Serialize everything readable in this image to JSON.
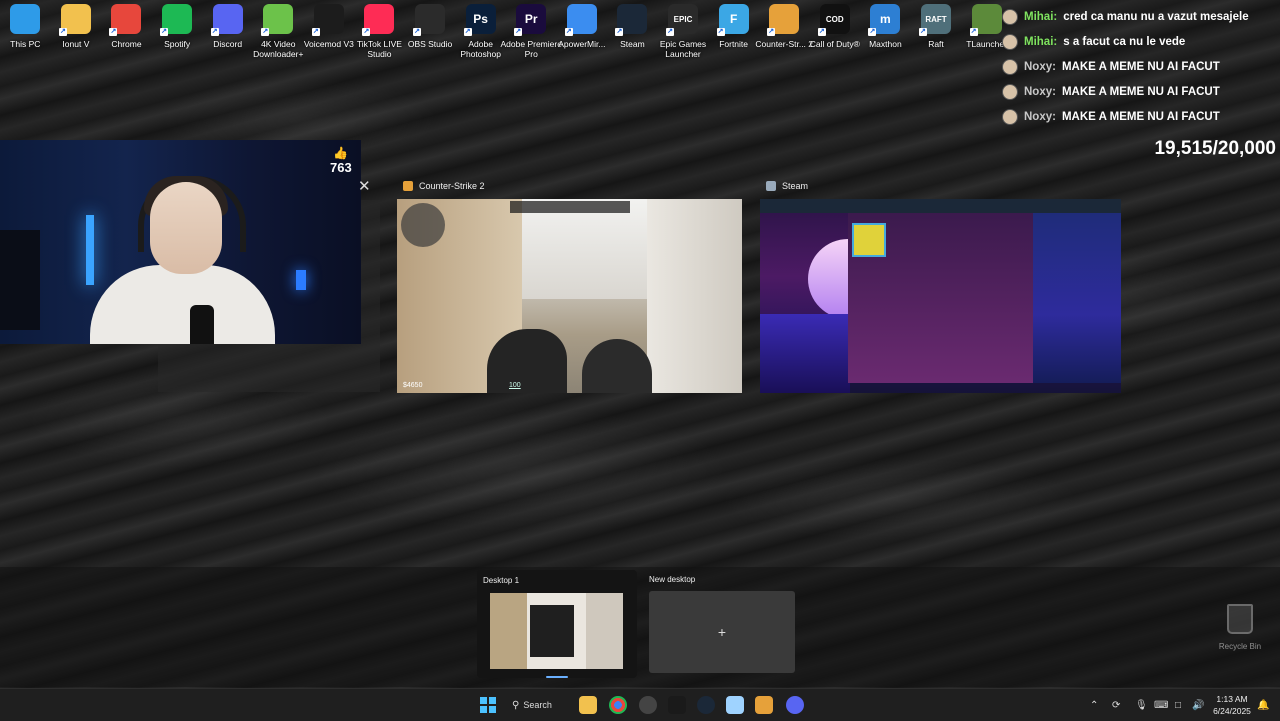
{
  "desktop_icons": [
    {
      "label": "This PC",
      "icon": "this-pc-icon",
      "color": "#2e9be8"
    },
    {
      "label": "Ionut V",
      "icon": "folder-icon",
      "color": "#f2c14e"
    },
    {
      "label": "Chrome",
      "icon": "chrome-icon",
      "color": "#e7473c"
    },
    {
      "label": "Spotify",
      "icon": "spotify-icon",
      "color": "#1db954"
    },
    {
      "label": "Discord",
      "icon": "discord-icon",
      "color": "#5865f2"
    },
    {
      "label": "4K Video Downloader+",
      "icon": "4k-video-downloader-icon",
      "color": "#6cc24a"
    },
    {
      "label": "Voicemod V3",
      "icon": "voicemod-icon",
      "color": "#1c1c1c"
    },
    {
      "label": "TikTok LIVE Studio",
      "icon": "tiktok-icon",
      "color": "#fe2c55"
    },
    {
      "label": "OBS Studio",
      "icon": "obs-icon",
      "color": "#2b2b2b"
    },
    {
      "label": "Adobe Photoshop",
      "icon": "photoshop-icon",
      "color": "#0a1f3a",
      "glyph": "Ps"
    },
    {
      "label": "Adobe Premiere Pro",
      "icon": "premiere-icon",
      "color": "#1a0b3d",
      "glyph": "Pr"
    },
    {
      "label": "ApowerMir...",
      "icon": "apowermirror-icon",
      "color": "#3b8df0"
    },
    {
      "label": "Steam",
      "icon": "steam-icon",
      "color": "#1b2838"
    },
    {
      "label": "Epic Games Launcher",
      "icon": "epic-games-icon",
      "color": "#2a2a2a",
      "glyph": "EPIC"
    },
    {
      "label": "Fortnite",
      "icon": "fortnite-icon",
      "color": "#3ba7e5",
      "glyph": "F"
    },
    {
      "label": "Counter-Str... 2",
      "icon": "counter-strike-icon",
      "color": "#e6a13a"
    },
    {
      "label": "Call of Duty®",
      "icon": "call-of-duty-icon",
      "color": "#111111",
      "glyph": "COD"
    },
    {
      "label": "Maxthon",
      "icon": "maxthon-icon",
      "color": "#2d7fd3",
      "glyph": "m"
    },
    {
      "label": "Raft",
      "icon": "raft-icon",
      "color": "#4f6f7a",
      "glyph": "RAFT"
    },
    {
      "label": "TLauncher",
      "icon": "tlauncher-icon",
      "color": "#5c8a3a"
    }
  ],
  "chat": [
    {
      "user": "Mihai:",
      "message": "cred ca manu nu a vazut mesajele",
      "user_color": "#7fe35f"
    },
    {
      "user": "Mihai:",
      "message": "s a facut ca nu le vede",
      "user_color": "#7fe35f"
    },
    {
      "user": "Noxy:",
      "message": "MAKE A MEME NU AI FACUT",
      "user_color": "#c8c8c8"
    },
    {
      "user": "Noxy:",
      "message": "MAKE A MEME NU AI FACUT",
      "user_color": "#c8c8c8"
    },
    {
      "user": "Noxy:",
      "message": "MAKE A MEME NU AI FACUT",
      "user_color": "#c8c8c8"
    }
  ],
  "like_goal": "19,515/20,000",
  "likes_count": "763",
  "windows": [
    {
      "title": "Counter-Strike 2",
      "money": "$4650",
      "health": "100"
    },
    {
      "title": "Steam"
    }
  ],
  "desktops": {
    "current_label": "Desktop 1",
    "new_label": "New desktop",
    "add_glyph": "+"
  },
  "recycle_bin": "Recycle Bin",
  "taskbar": {
    "search_label": "Search",
    "time": "1:13 AM",
    "date": "6/24/2025"
  },
  "colors": {
    "accent": "#4cc2ff"
  }
}
